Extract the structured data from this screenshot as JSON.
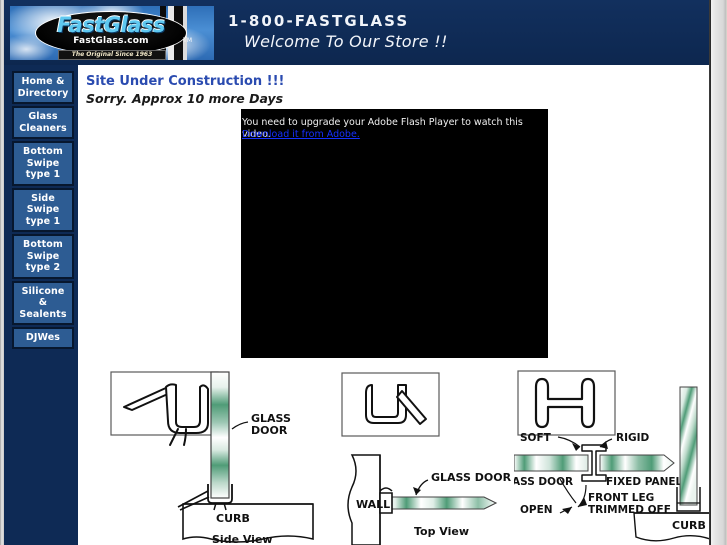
{
  "header": {
    "logo": {
      "brand": "FastGlass",
      "domain": "FastGlass.com",
      "tagline": "The Original Since 1963",
      "trademark": "TM"
    },
    "phone": "1-800-FASTGLASS",
    "welcome": "Welcome To Our Store !!"
  },
  "sidebar": {
    "items": [
      {
        "label": "Home &\nDirectory",
        "name": "home-directory"
      },
      {
        "label": "Glass\nCleaners",
        "name": "glass-cleaners"
      },
      {
        "label": "Bottom\nSwipe\ntype 1",
        "name": "bottom-swipe-type-1"
      },
      {
        "label": "Side\nSwipe\ntype 1",
        "name": "side-swipe-type-1"
      },
      {
        "label": "Bottom\nSwipe\ntype 2",
        "name": "bottom-swipe-type-2"
      },
      {
        "label": "Silicone\n&\nSealents",
        "name": "silicone-sealents"
      },
      {
        "label": "DJWes",
        "name": "djwes"
      }
    ]
  },
  "main": {
    "construction_title": "Site Under Construction !!!",
    "construction_sub": "Sorry. Approx 10 more Days",
    "video": {
      "message": "You need to upgrade your Adobe Flash Player to watch this video.",
      "link_label": "Download it from Adobe."
    },
    "diagrams": [
      {
        "name": "bottom-swipe-side-view",
        "labels": {
          "glass_door": "GLASS\nDOOR",
          "curb": "CURB",
          "view": "Side View"
        }
      },
      {
        "name": "side-swipe-top-view",
        "labels": {
          "wall": "WALL",
          "glass_door": "GLASS DOOR",
          "view": "Top View"
        }
      },
      {
        "name": "h-seal-detail",
        "labels": {
          "soft": "SOFT",
          "rigid": "RIGID",
          "glass_door": "ASS DOOR",
          "fixed_panel": "FIXED PANEL",
          "front_leg": "FRONT LEG\nTRIMMED OFF",
          "open": "OPEN",
          "curb": "CURB"
        }
      }
    ]
  },
  "colors": {
    "header_navy": "#0f2e5c",
    "sidebar_navy": "#0e2a55",
    "button_blue": "#2d5c93",
    "title_blue": "#2a4bb0",
    "link_blue": "#1530ff",
    "glass_green": "#3f9168"
  }
}
